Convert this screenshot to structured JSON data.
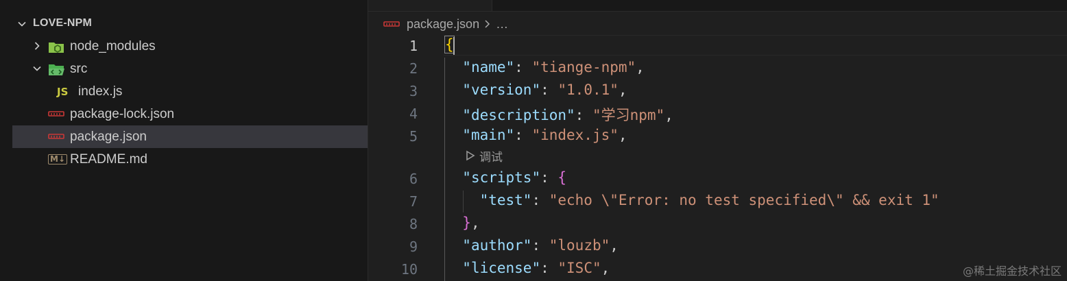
{
  "explorer": {
    "section_title": "LOVE-NPM",
    "items": [
      {
        "label": "node_modules"
      },
      {
        "label": "src"
      },
      {
        "label": "index.js",
        "icon_text": "JS"
      },
      {
        "label": "package-lock.json"
      },
      {
        "label": "package.json",
        "selected": true
      },
      {
        "label": "README.md",
        "icon_text": "M↓"
      }
    ]
  },
  "editor": {
    "breadcrumb": {
      "file": "package.json",
      "more": "…"
    },
    "codelens": "调试",
    "lines": [
      {
        "n": "1",
        "active": true
      },
      {
        "n": "2"
      },
      {
        "n": "3"
      },
      {
        "n": "4"
      },
      {
        "n": "5"
      },
      {
        "n": "6"
      },
      {
        "n": "7"
      },
      {
        "n": "8"
      },
      {
        "n": "9"
      },
      {
        "n": "10"
      }
    ],
    "code": {
      "l1_brace": "{",
      "name_key": "\"name\"",
      "name_val": "\"tiange-npm\"",
      "version_key": "\"version\"",
      "version_val": "\"1.0.1\"",
      "description_key": "\"description\"",
      "description_val": "\"学习npm\"",
      "main_key": "\"main\"",
      "main_val": "\"index.js\"",
      "scripts_key": "\"scripts\"",
      "scripts_open": "{",
      "test_key": "\"test\"",
      "test_val": "\"echo \\\"Error: no test specified\\\" && exit 1\"",
      "scripts_close": "}",
      "author_key": "\"author\"",
      "author_val": "\"louzb\"",
      "license_key": "\"license\"",
      "license_val": "\"ISC\""
    }
  },
  "watermark": "@稀土掘金技术社区",
  "colors": {
    "sidebar_bg": "#181818",
    "editor_bg": "#1f1f1f",
    "selected_row": "#37373d",
    "json_key": "#9cdcfe",
    "json_string": "#ce9178",
    "bracket_level1": "#ffd700",
    "bracket_level2": "#da70d6"
  },
  "icons": {
    "folder_node": "node-folder-icon",
    "folder_src": "src-folder-icon",
    "json_file": "json-file-icon",
    "js_file": "js-file-icon",
    "markdown_file": "markdown-file-icon"
  }
}
